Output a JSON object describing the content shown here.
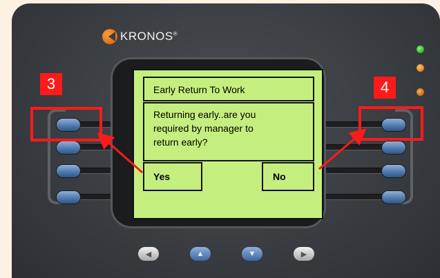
{
  "brand": {
    "logo_text": "KRONOS",
    "reg_mark": "®"
  },
  "screen": {
    "title": "Early Return To Work",
    "message_lines": [
      "Returning early..are you",
      "required by manager to",
      "return early?"
    ],
    "option_left": "Yes",
    "option_right": "No"
  },
  "annotations": {
    "left_number": "3",
    "right_number": "4",
    "color": "#ff1a1a"
  },
  "nav": [
    "left-arrow-icon",
    "up-arrow-icon",
    "down-arrow-icon",
    "right-arrow-icon"
  ]
}
